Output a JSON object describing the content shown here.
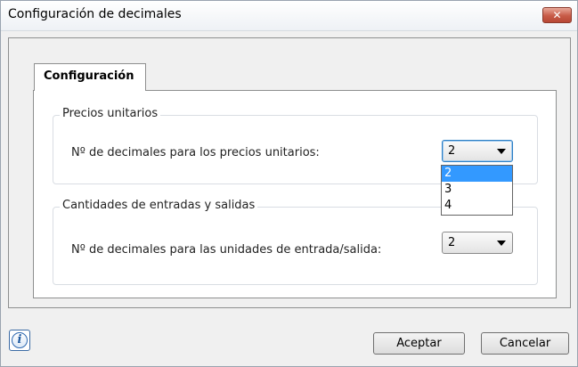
{
  "window": {
    "title": "Configuración de decimales",
    "close_label": "✕"
  },
  "tabs": [
    {
      "label": "Configuración"
    }
  ],
  "groups": {
    "precios": {
      "title": "Precios unitarios",
      "field_label": "Nº de decimales para los precios unitarios:",
      "selected": "2",
      "options": [
        "2",
        "3",
        "4"
      ]
    },
    "cantidades": {
      "title": "Cantidades de entradas y salidas",
      "field_label": "Nº de decimales para las unidades de entrada/salida:",
      "selected": "2"
    }
  },
  "footer": {
    "info_icon": "i",
    "accept_label": "Aceptar",
    "cancel_label": "Cancelar"
  },
  "colors": {
    "selection": "#3399ff",
    "focus_border": "#2d7fc4",
    "close_button": "#c75b47"
  }
}
